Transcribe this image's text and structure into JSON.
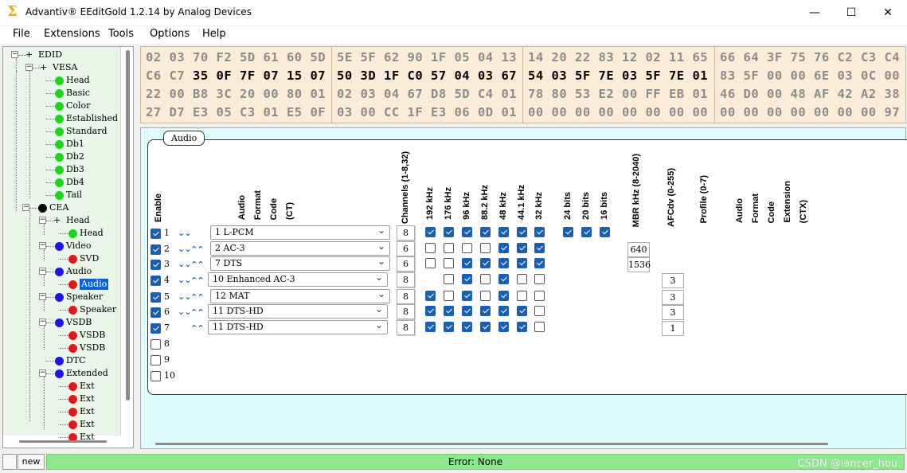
{
  "window": {
    "title": "Advantiv® EEditGold 1.2.14 by Analog Devices",
    "icon": "Σ",
    "minimize": "—",
    "maximize": "☐",
    "close": "✕"
  },
  "menu": [
    "File",
    "Extensions",
    "Tools",
    "Options",
    "Help"
  ],
  "tree": {
    "root": "EDID",
    "vesa": "VESA",
    "vesa_children": [
      "Head",
      "Basic",
      "Color",
      "Established",
      "Standard",
      "Db1",
      "Db2",
      "Db3",
      "Db4",
      "Tail"
    ],
    "cea": "CEA",
    "cea_head": "Head",
    "cea_head_child": "Head",
    "video": "Video",
    "video_child": "SVD",
    "audio": "Audio",
    "audio_child": "Audio",
    "speaker": "Speaker",
    "speaker_child": "Speaker",
    "vsdb": "VSDB",
    "vsdb_children": [
      "VSDB",
      "VSDB"
    ],
    "dtc": "DTC",
    "extended": "Extended",
    "extended_children": [
      "Ext",
      "Ext",
      "Ext",
      "Ext",
      "Ext"
    ],
    "colors": {
      "green": "#1fd21f",
      "blue": "#1a1ad8",
      "red": "#e01818",
      "black": "#000000"
    }
  },
  "hex": {
    "groups": [
      [
        [
          {
            "t": "02 03 70 F2 5D 61 60 5D",
            "h": false
          }
        ],
        [
          {
            "t": "C6 C7 ",
            "h": false
          },
          {
            "t": "35 0F 7F 07 15 07",
            "h": true
          }
        ],
        [
          {
            "t": "22 00 B8 3C 20 00 80 01",
            "h": false
          }
        ],
        [
          {
            "t": "27 D7 E3 05 C3 01 E5 0F",
            "h": false
          }
        ]
      ],
      [
        [
          {
            "t": "5E 5F 62 90 1F 05 04 13",
            "h": false
          }
        ],
        [
          {
            "t": "50 3D 1F C0 57 04 03 67",
            "h": true
          }
        ],
        [
          {
            "t": "02 03 04 67 D8 5D C4 01",
            "h": false
          }
        ],
        [
          {
            "t": "03 00 CC 1F E3 06 0D 01",
            "h": false
          }
        ]
      ],
      [
        [
          {
            "t": "14 20 22 83 12 02 11 65",
            "h": false
          }
        ],
        [
          {
            "t": "54 03 5F 7E 03 5F 7E 01",
            "h": true
          }
        ],
        [
          {
            "t": "78 80 53 E2 00 FF EB 01",
            "h": false
          }
        ],
        [
          {
            "t": "00 00 00 00 00 00 00 00",
            "h": false
          }
        ]
      ],
      [
        [
          {
            "t": "66 64 3F 75 76 C2 C3 C4",
            "h": false
          }
        ],
        [
          {
            "t": "83 5F 00 00 6E 03 0C 00",
            "h": false
          }
        ],
        [
          {
            "t": "46 D0 00 48 AF 42 A2 38",
            "h": false
          }
        ],
        [
          {
            "t": "00 00 00 00 00 00 00 97",
            "h": false
          }
        ]
      ]
    ]
  },
  "audio": {
    "tab_label": "Audio",
    "headers": {
      "enable": "Enable",
      "afc_lines": [
        "Audio",
        "Format",
        "Code",
        "(CT)"
      ],
      "channels": "Channels (1-8,32)",
      "rates": [
        "192 kHz",
        "176 kHz",
        "96 kHz",
        "88.2 kHz",
        "48 kHz",
        "44.1 kHz",
        "32 kHz"
      ],
      "bits": [
        "24 bits",
        "20 bits",
        "16 bits"
      ],
      "mbr": "MBR kHz (8-2040)",
      "afcdv": "AFCdv (0-255)",
      "profile": "Profile (0-7)",
      "ext_lines": [
        "Audio",
        "Format",
        "Code",
        "Extension",
        "(CTX)"
      ]
    },
    "rows": [
      {
        "num": "1",
        "enabled": true,
        "down": true,
        "up": false,
        "format": "1   L-PCM",
        "channels": "8",
        "rates": [
          true,
          true,
          true,
          true,
          true,
          true,
          true
        ],
        "bits": [
          true,
          true,
          true
        ],
        "mbr": "",
        "afcdv": ""
      },
      {
        "num": "2",
        "enabled": true,
        "down": true,
        "up": true,
        "format": "2   AC-3",
        "channels": "6",
        "rates": [
          false,
          false,
          false,
          false,
          true,
          true,
          true
        ],
        "bits": null,
        "mbr": "640",
        "afcdv": ""
      },
      {
        "num": "3",
        "enabled": true,
        "down": true,
        "up": true,
        "format": "7   DTS",
        "channels": "6",
        "rates": [
          false,
          false,
          true,
          true,
          true,
          true,
          true
        ],
        "bits": null,
        "mbr": "1536",
        "afcdv": ""
      },
      {
        "num": "4",
        "enabled": true,
        "down": true,
        "up": true,
        "format": "10   Enhanced AC-3",
        "channels": "8",
        "rates": [
          null,
          false,
          true,
          false,
          true,
          false,
          false
        ],
        "bits": null,
        "mbr": "",
        "afcdv": "3"
      },
      {
        "num": "5",
        "enabled": true,
        "down": true,
        "up": true,
        "format": "12   MAT",
        "channels": "8",
        "rates": [
          true,
          false,
          true,
          false,
          true,
          false,
          false
        ],
        "bits": null,
        "mbr": "",
        "afcdv": "3"
      },
      {
        "num": "6",
        "enabled": true,
        "down": true,
        "up": true,
        "format": "11   DTS-HD",
        "channels": "8",
        "rates": [
          true,
          true,
          true,
          true,
          true,
          true,
          false
        ],
        "bits": null,
        "mbr": "",
        "afcdv": "3"
      },
      {
        "num": "7",
        "enabled": true,
        "down": false,
        "up": true,
        "format": "11   DTS-HD",
        "channels": "8",
        "rates": [
          true,
          true,
          true,
          true,
          true,
          true,
          false
        ],
        "bits": null,
        "mbr": "",
        "afcdv": "1"
      },
      {
        "num": "8",
        "enabled": false
      },
      {
        "num": "9",
        "enabled": false
      },
      {
        "num": "10",
        "enabled": false
      }
    ]
  },
  "status": {
    "mode": "new",
    "message": "Error: None",
    "watermark": "CSDN @lancer_hou"
  }
}
